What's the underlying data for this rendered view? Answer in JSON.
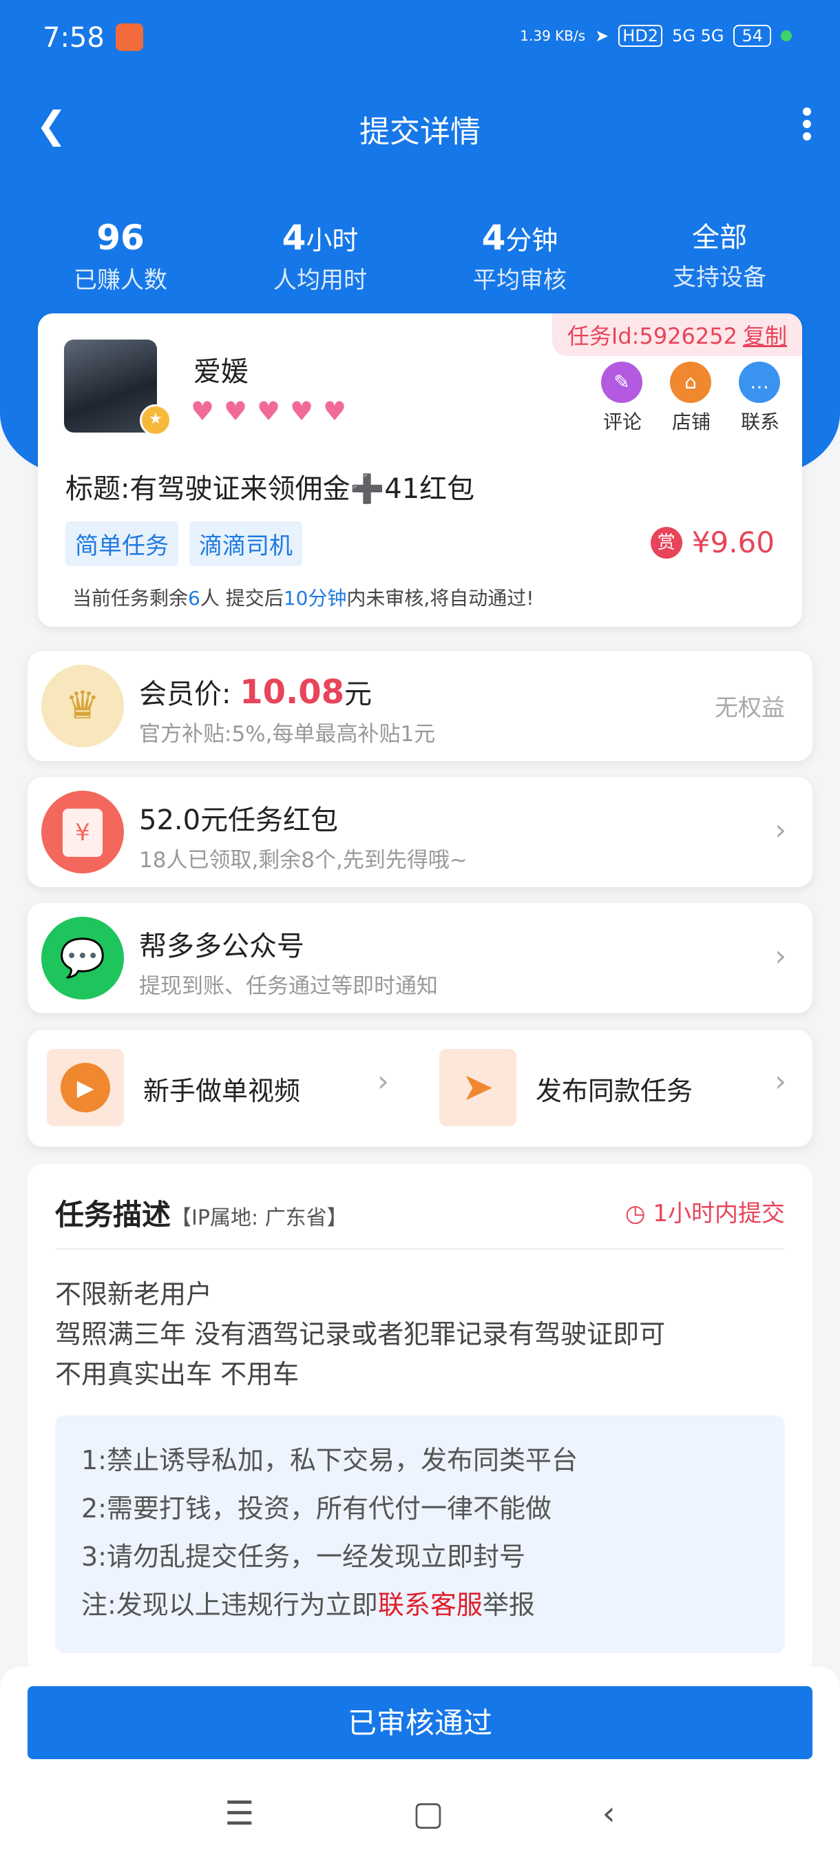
{
  "status_bar": {
    "time": "7:58",
    "speed": "1.39 KB/s",
    "hd": "HD2",
    "network": "5G 5G",
    "battery": "54"
  },
  "nav": {
    "title": "提交详情"
  },
  "stats": [
    {
      "value": "96",
      "unit": "",
      "label": "已赚人数"
    },
    {
      "value": "4",
      "unit": "小时",
      "label": "人均用时"
    },
    {
      "value": "4",
      "unit": "分钟",
      "label": "平均审核"
    },
    {
      "value": "全部",
      "unit": "",
      "label": "支持设备"
    }
  ],
  "task": {
    "task_id_label": "任务Id:5926252",
    "copy_label": "复制",
    "username": "爱媛",
    "hearts": 5,
    "actions": [
      "评论",
      "店铺",
      "联系"
    ],
    "title": "标题:有驾驶证来领佣金➕41红包",
    "tags": [
      "简单任务",
      "滴滴司机"
    ],
    "reward_badge": "赏",
    "reward": "¥9.60",
    "notice_a": "当前任务剩余",
    "notice_count": "6",
    "notice_b": "人  提交后",
    "notice_time": "10分钟",
    "notice_c": "内未审核,将自动通过!"
  },
  "member": {
    "label": "会员价:",
    "price": "10.08",
    "unit": "元",
    "sub": "官方补贴:5%,每单最高补贴1元",
    "right": "无权益"
  },
  "redpack": {
    "title": "52.0元任务红包",
    "sub": "18人已领取,剩余8个,先到先得哦~"
  },
  "wechat": {
    "title": "帮多多公众号",
    "sub": "提现到账、任务通过等即时通知"
  },
  "links": [
    {
      "label": "新手做单视频"
    },
    {
      "label": "发布同款任务"
    }
  ],
  "description": {
    "heading": "任务描述",
    "ip": "【IP属地: 广东省】",
    "timer": "1小时内提交",
    "lines": [
      "不限新老用户",
      "驾照满三年 没有酒驾记录或者犯罪记录有驾驶证即可",
      "不用真实出车  不用车"
    ],
    "rules": [
      "1:禁止诱导私加，私下交易，发布同类平台",
      "2:需要打钱，投资，所有代付一律不能做",
      "3:请勿乱提交任务，一经发现立即封号"
    ],
    "rule_note_a": "注:发现以上违规行为立即",
    "rule_note_link": "联系客服",
    "rule_note_b": "举报"
  },
  "bottom": {
    "button": "已审核通过"
  }
}
